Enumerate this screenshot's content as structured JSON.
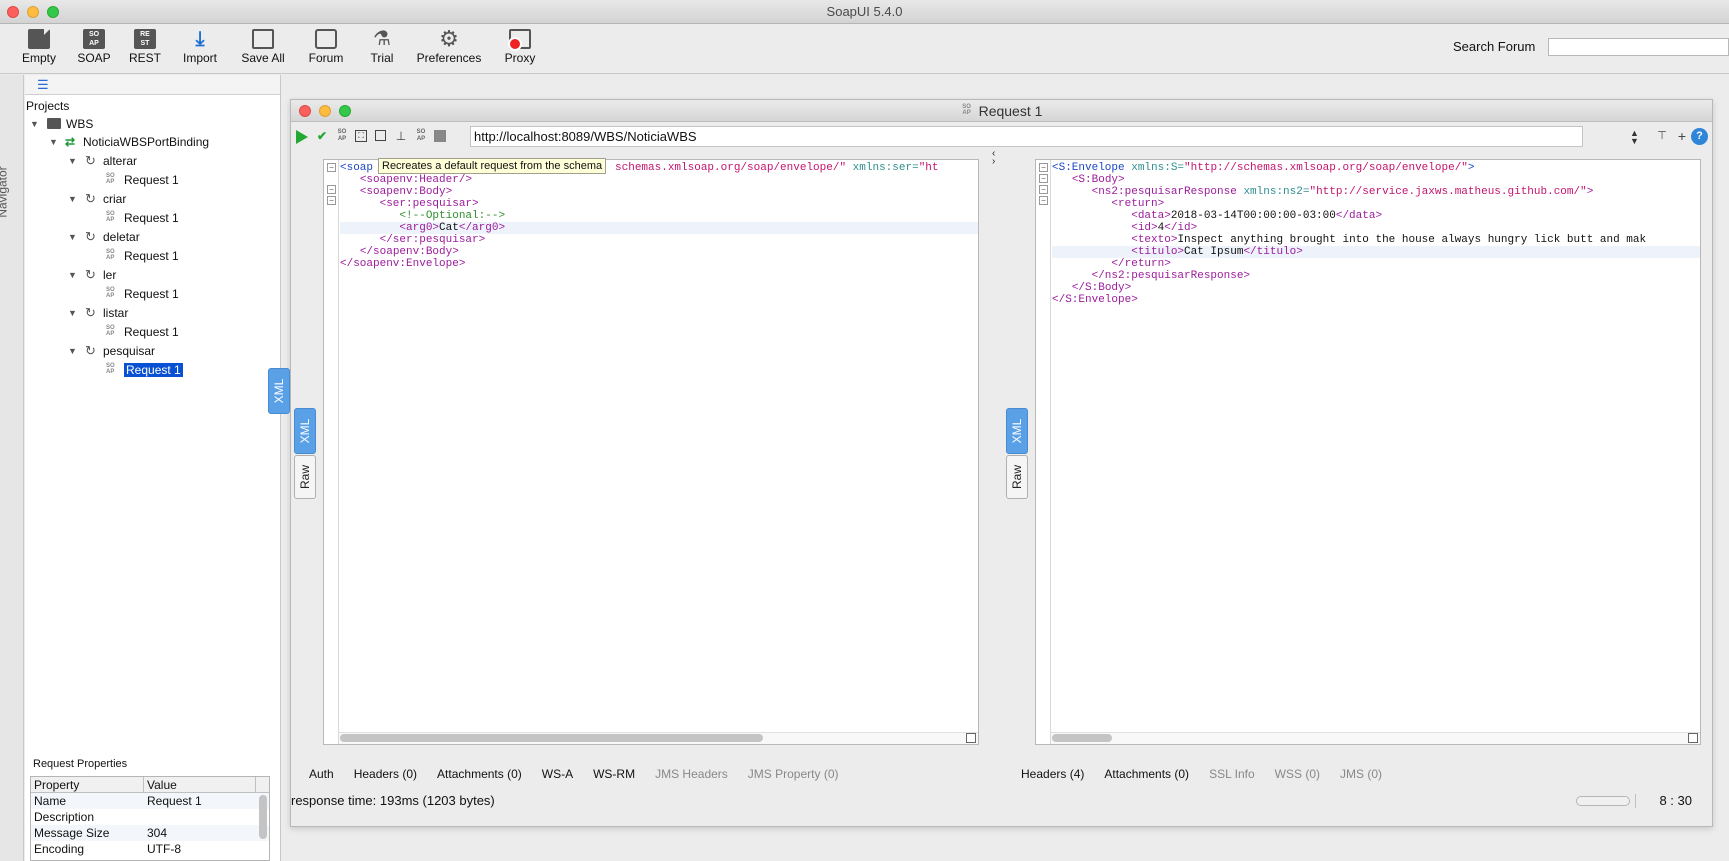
{
  "app_title": "SoapUI 5.4.0",
  "toolbar": {
    "empty": "Empty",
    "soap": "SOAP",
    "rest": "REST",
    "import": "Import",
    "save_all": "Save All",
    "forum": "Forum",
    "trial": "Trial",
    "preferences": "Preferences",
    "proxy": "Proxy",
    "search_forum_label": "Search Forum",
    "search_forum_value": ""
  },
  "navigator": {
    "vertical_label": "Navigator",
    "projects_label": "Projects",
    "project": "WBS",
    "binding": "NoticiaWBSPortBinding",
    "operations": [
      {
        "name": "alterar",
        "request": "Request 1"
      },
      {
        "name": "criar",
        "request": "Request 1"
      },
      {
        "name": "deletar",
        "request": "Request 1"
      },
      {
        "name": "ler",
        "request": "Request 1"
      },
      {
        "name": "listar",
        "request": "Request 1"
      },
      {
        "name": "pesquisar",
        "request": "Request 1"
      }
    ],
    "soap_icon_text": "SO AP"
  },
  "request_properties": {
    "title": "Request Properties",
    "headers": [
      "Property",
      "Value"
    ],
    "rows": [
      {
        "property": "Name",
        "value": "Request 1"
      },
      {
        "property": "Description",
        "value": ""
      },
      {
        "property": "Message Size",
        "value": "304"
      },
      {
        "property": "Encoding",
        "value": "UTF-8"
      }
    ]
  },
  "request_window": {
    "title": "Request 1",
    "url": "http://localhost:8089/WBS/NoticiaWBS",
    "tooltip": "Recreates a default request from the schema",
    "tab_xml": "XML",
    "tab_raw": "Raw",
    "request_tabs": [
      {
        "label": "Auth",
        "dim": false
      },
      {
        "label": "Headers (0)",
        "dim": false
      },
      {
        "label": "Attachments (0)",
        "dim": false
      },
      {
        "label": "WS-A",
        "dim": false
      },
      {
        "label": "WS-RM",
        "dim": false
      },
      {
        "label": "JMS Headers",
        "dim": true
      },
      {
        "label": "JMS Property (0)",
        "dim": true
      }
    ],
    "response_tabs": [
      {
        "label": "Headers (4)",
        "dim": false
      },
      {
        "label": "Attachments (0)",
        "dim": false
      },
      {
        "label": "SSL Info",
        "dim": true
      },
      {
        "label": "WSS (0)",
        "dim": true
      },
      {
        "label": "JMS (0)",
        "dim": true
      }
    ]
  },
  "request_xml": {
    "l1_open": "<soap",
    "l1_ns": "schemas.xmlsoap.org/soap/envelope/\"",
    "l1_attr": " xmlns:ser=",
    "l1_val": "\"ht",
    "l2": "<soapenv:Header/>",
    "l3": "<soapenv:Body>",
    "l4": "<ser:pesquisar>",
    "l5": "<!--Optional:-->",
    "l6_open": "<arg0>",
    "l6_text": "Cat",
    "l6_close": "</arg0>",
    "l7": "</ser:pesquisar>",
    "l8": "</soapenv:Body>",
    "l9": "</soapenv:Envelope>"
  },
  "response_xml": {
    "l1_tag": "<S:Envelope",
    "l1_attr": " xmlns:S=",
    "l1_val": "\"http://schemas.xmlsoap.org/soap/envelope/\"",
    "l1_end": ">",
    "l2": "<S:Body>",
    "l3_tag": "<ns2:pesquisarResponse",
    "l3_attr": " xmlns:ns2=",
    "l3_val": "\"http://service.jaxws.matheus.github.com/\"",
    "l3_end": ">",
    "l4": "<return>",
    "l5_open": "<data>",
    "l5_text": "2018-03-14T00:00:00-03:00",
    "l5_close": "</data>",
    "l6_open": "<id>",
    "l6_text": "4",
    "l6_close": "</id>",
    "l7_open": "<texto>",
    "l7_text": "Inspect anything brought into the house always hungry lick butt and mak",
    "l8_open": "<titulo>",
    "l8_text": "Cat Ipsum",
    "l8_close": "</titulo>",
    "l9": "</return>",
    "l10": "</ns2:pesquisarResponse>",
    "l11": "</S:Body>",
    "l12": "</S:Envelope>"
  },
  "status": {
    "response_time": "response time: 193ms (1203 bytes)",
    "cursor_position": "8 : 30"
  },
  "colors": {
    "selection": "#0a50d2",
    "xml_tab_active": "#5aa0e6",
    "run_green": "#23a832"
  }
}
